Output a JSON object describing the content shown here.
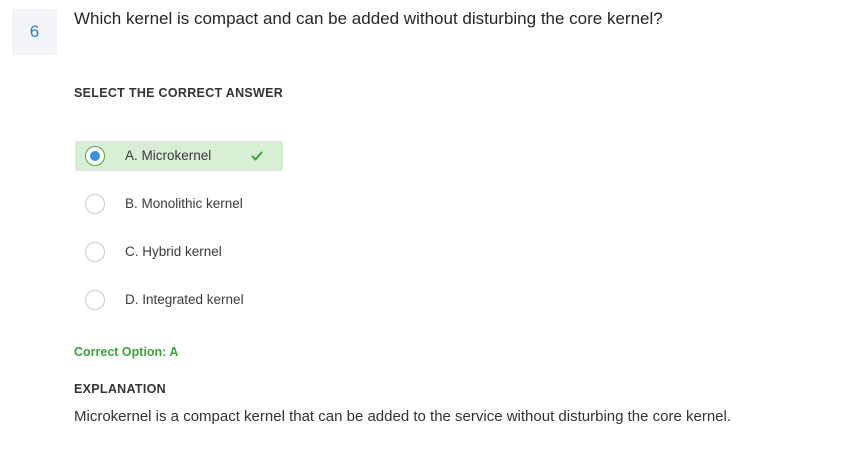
{
  "question": {
    "number": "6",
    "text": "Which kernel is compact and can be added without disturbing the core kernel?"
  },
  "prompt": "SELECT THE CORRECT ANSWER",
  "options": [
    {
      "label": "A. Microkernel",
      "selected": true,
      "correct": true
    },
    {
      "label": "B. Monolithic kernel",
      "selected": false,
      "correct": false
    },
    {
      "label": "C. Hybrid kernel",
      "selected": false,
      "correct": false
    },
    {
      "label": "D. Integrated kernel",
      "selected": false,
      "correct": false
    }
  ],
  "result": {
    "correct_option": "Correct Option: A"
  },
  "explanation": {
    "heading": "EXPLANATION",
    "text": "Microkernel is a compact kernel that can be added to the service without disturbing the core kernel."
  },
  "colors": {
    "question_number": "#2a7fd4",
    "correct_bg": "#d8efd6",
    "correct_text": "#3aa33d",
    "radio_selected": "#3a8fe0"
  },
  "icons": {
    "selected_radio": "radio-selected-icon",
    "correct_mark": "checkmark-icon"
  }
}
